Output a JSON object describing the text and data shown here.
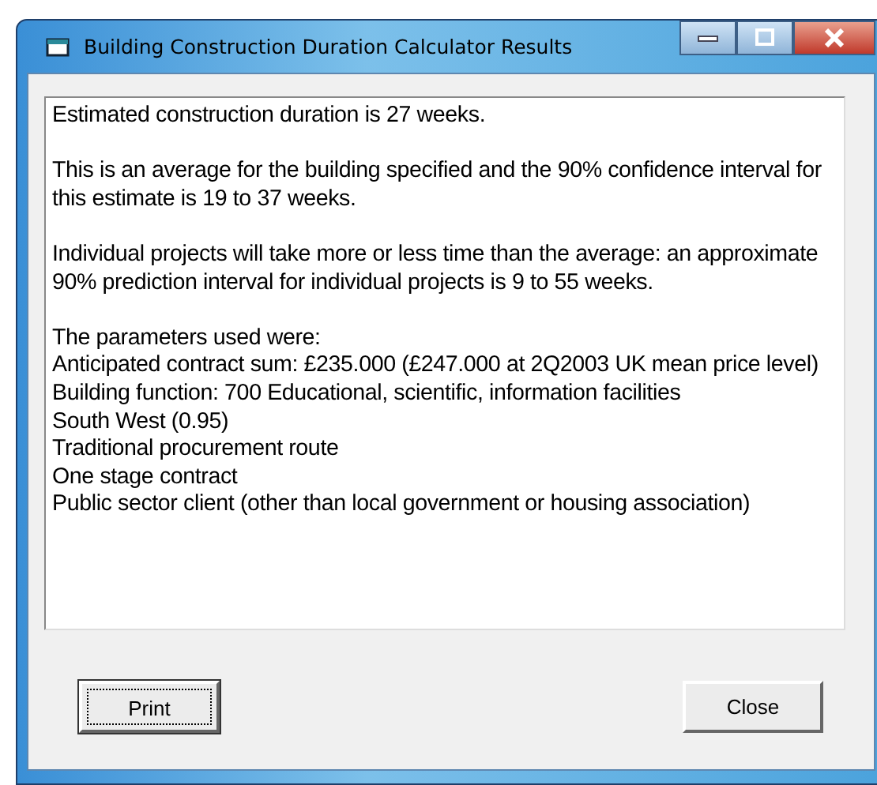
{
  "window": {
    "title": "Building Construction Duration Calculator Results"
  },
  "results": {
    "paragraphs": [
      "Estimated construction duration is 27 weeks.",
      "This is an average for the building specified and the 90% confidence interval for this estimate is 19 to 37 weeks.",
      "Individual projects will take more or less time than the average: an approximate 90% prediction interval for individual projects is 9 to 55 weeks."
    ],
    "parameters_heading": "The parameters used were:",
    "parameters": [
      "Anticipated contract sum: £235.000 (£247.000 at 2Q2003 UK mean price level)",
      "Building function: 700 Educational, scientific, information facilities",
      "South West (0.95)",
      "Traditional procurement route",
      "One stage contract",
      "Public sector client (other than local government or housing association)"
    ]
  },
  "buttons": [
    {
      "label": "Print",
      "focused": true
    },
    {
      "label": "Close",
      "focused": false
    }
  ]
}
